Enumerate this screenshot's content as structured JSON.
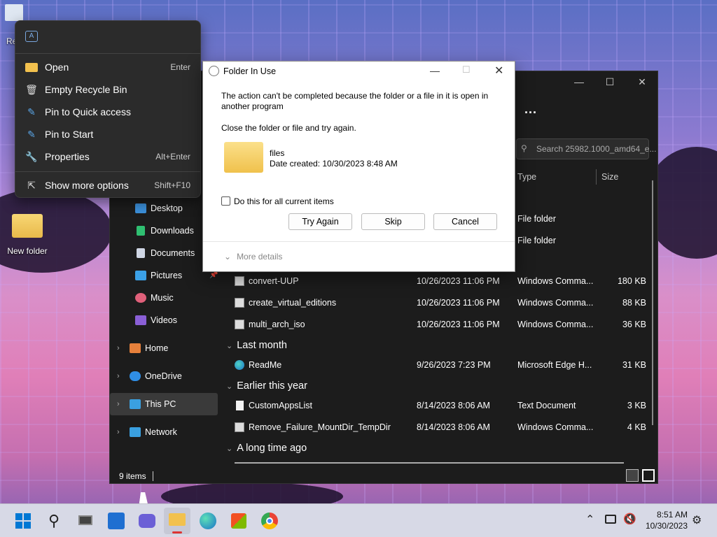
{
  "desktop": {
    "icons": [
      {
        "label": "Re",
        "name": "recycle-bin"
      },
      {
        "label": "New folder",
        "name": "new-folder"
      }
    ]
  },
  "context_menu": {
    "items": [
      {
        "label": "Open",
        "shortcut": "Enter",
        "icon": "folder-icon"
      },
      {
        "label": "Empty Recycle Bin",
        "shortcut": "",
        "icon": "trash-icon"
      },
      {
        "label": "Pin to Quick access",
        "shortcut": "",
        "icon": "pin-icon"
      },
      {
        "label": "Pin to Start",
        "shortcut": "",
        "icon": "pin-icon"
      },
      {
        "label": "Properties",
        "shortcut": "Alt+Enter",
        "icon": "wrench-icon"
      },
      {
        "label": "Show more options",
        "shortcut": "Shift+F10",
        "icon": "share-icon"
      }
    ]
  },
  "dialog": {
    "title": "Folder In Use",
    "message1": "The action can't be completed because the folder or a file in it is open in another program",
    "message2": "Close the folder or file and try again.",
    "file_name": "files",
    "file_date": "Date created: 10/30/2023 8:48 AM",
    "checkbox_label": "Do this for all current items",
    "try_again": "Try Again",
    "skip": "Skip",
    "cancel": "Cancel",
    "more_details": "More details"
  },
  "explorer": {
    "search_placeholder": "Search 25982.1000_amd64_e...",
    "columns": {
      "type": "Type",
      "size": "Size"
    },
    "more": "...",
    "nav": [
      {
        "label": "Desktop",
        "icon": "desktop-icon",
        "color": "#3b8fd9"
      },
      {
        "label": "Downloads",
        "icon": "download-icon",
        "color": "#2fbf71"
      },
      {
        "label": "Documents",
        "icon": "document-icon",
        "color": "#cfd6e4"
      },
      {
        "label": "Pictures",
        "icon": "pictures-icon",
        "color": "#3ba0e6"
      },
      {
        "label": "Music",
        "icon": "music-icon",
        "color": "#e0607a"
      },
      {
        "label": "Videos",
        "icon": "videos-icon",
        "color": "#8a5fd6"
      }
    ],
    "nav_roots": [
      {
        "label": "Home",
        "icon": "home-icon"
      },
      {
        "label": "OneDrive",
        "icon": "cloud-icon"
      },
      {
        "label": "This PC",
        "icon": "pc-icon"
      },
      {
        "label": "Network",
        "icon": "network-icon"
      }
    ],
    "top_rows": [
      {
        "type": "File folder"
      },
      {
        "type": "File folder"
      }
    ],
    "rows_a": [
      {
        "name": "convert-UUP",
        "date": "10/26/2023 11:06 PM",
        "type": "Windows Comma...",
        "size": "180 KB"
      },
      {
        "name": "create_virtual_editions",
        "date": "10/26/2023 11:06 PM",
        "type": "Windows Comma...",
        "size": "88 KB"
      },
      {
        "name": "multi_arch_iso",
        "date": "10/26/2023 11:06 PM",
        "type": "Windows Comma...",
        "size": "36 KB"
      }
    ],
    "group_last_month": "Last month",
    "rows_b": [
      {
        "name": "ReadMe",
        "date": "9/26/2023 7:23 PM",
        "type": "Microsoft Edge H...",
        "size": "31 KB"
      }
    ],
    "group_earlier": "Earlier this year",
    "rows_c": [
      {
        "name": "CustomAppsList",
        "date": "8/14/2023 8:06 AM",
        "type": "Text Document",
        "size": "3 KB"
      },
      {
        "name": "Remove_Failure_MountDir_TempDir",
        "date": "8/14/2023 8:06 AM",
        "type": "Windows Comma...",
        "size": "4 KB"
      }
    ],
    "group_long_ago": "A long time ago",
    "status": "9 items"
  },
  "taskbar": {
    "time": "8:51 AM",
    "date": "10/30/2023",
    "accent": "#0078d4"
  }
}
